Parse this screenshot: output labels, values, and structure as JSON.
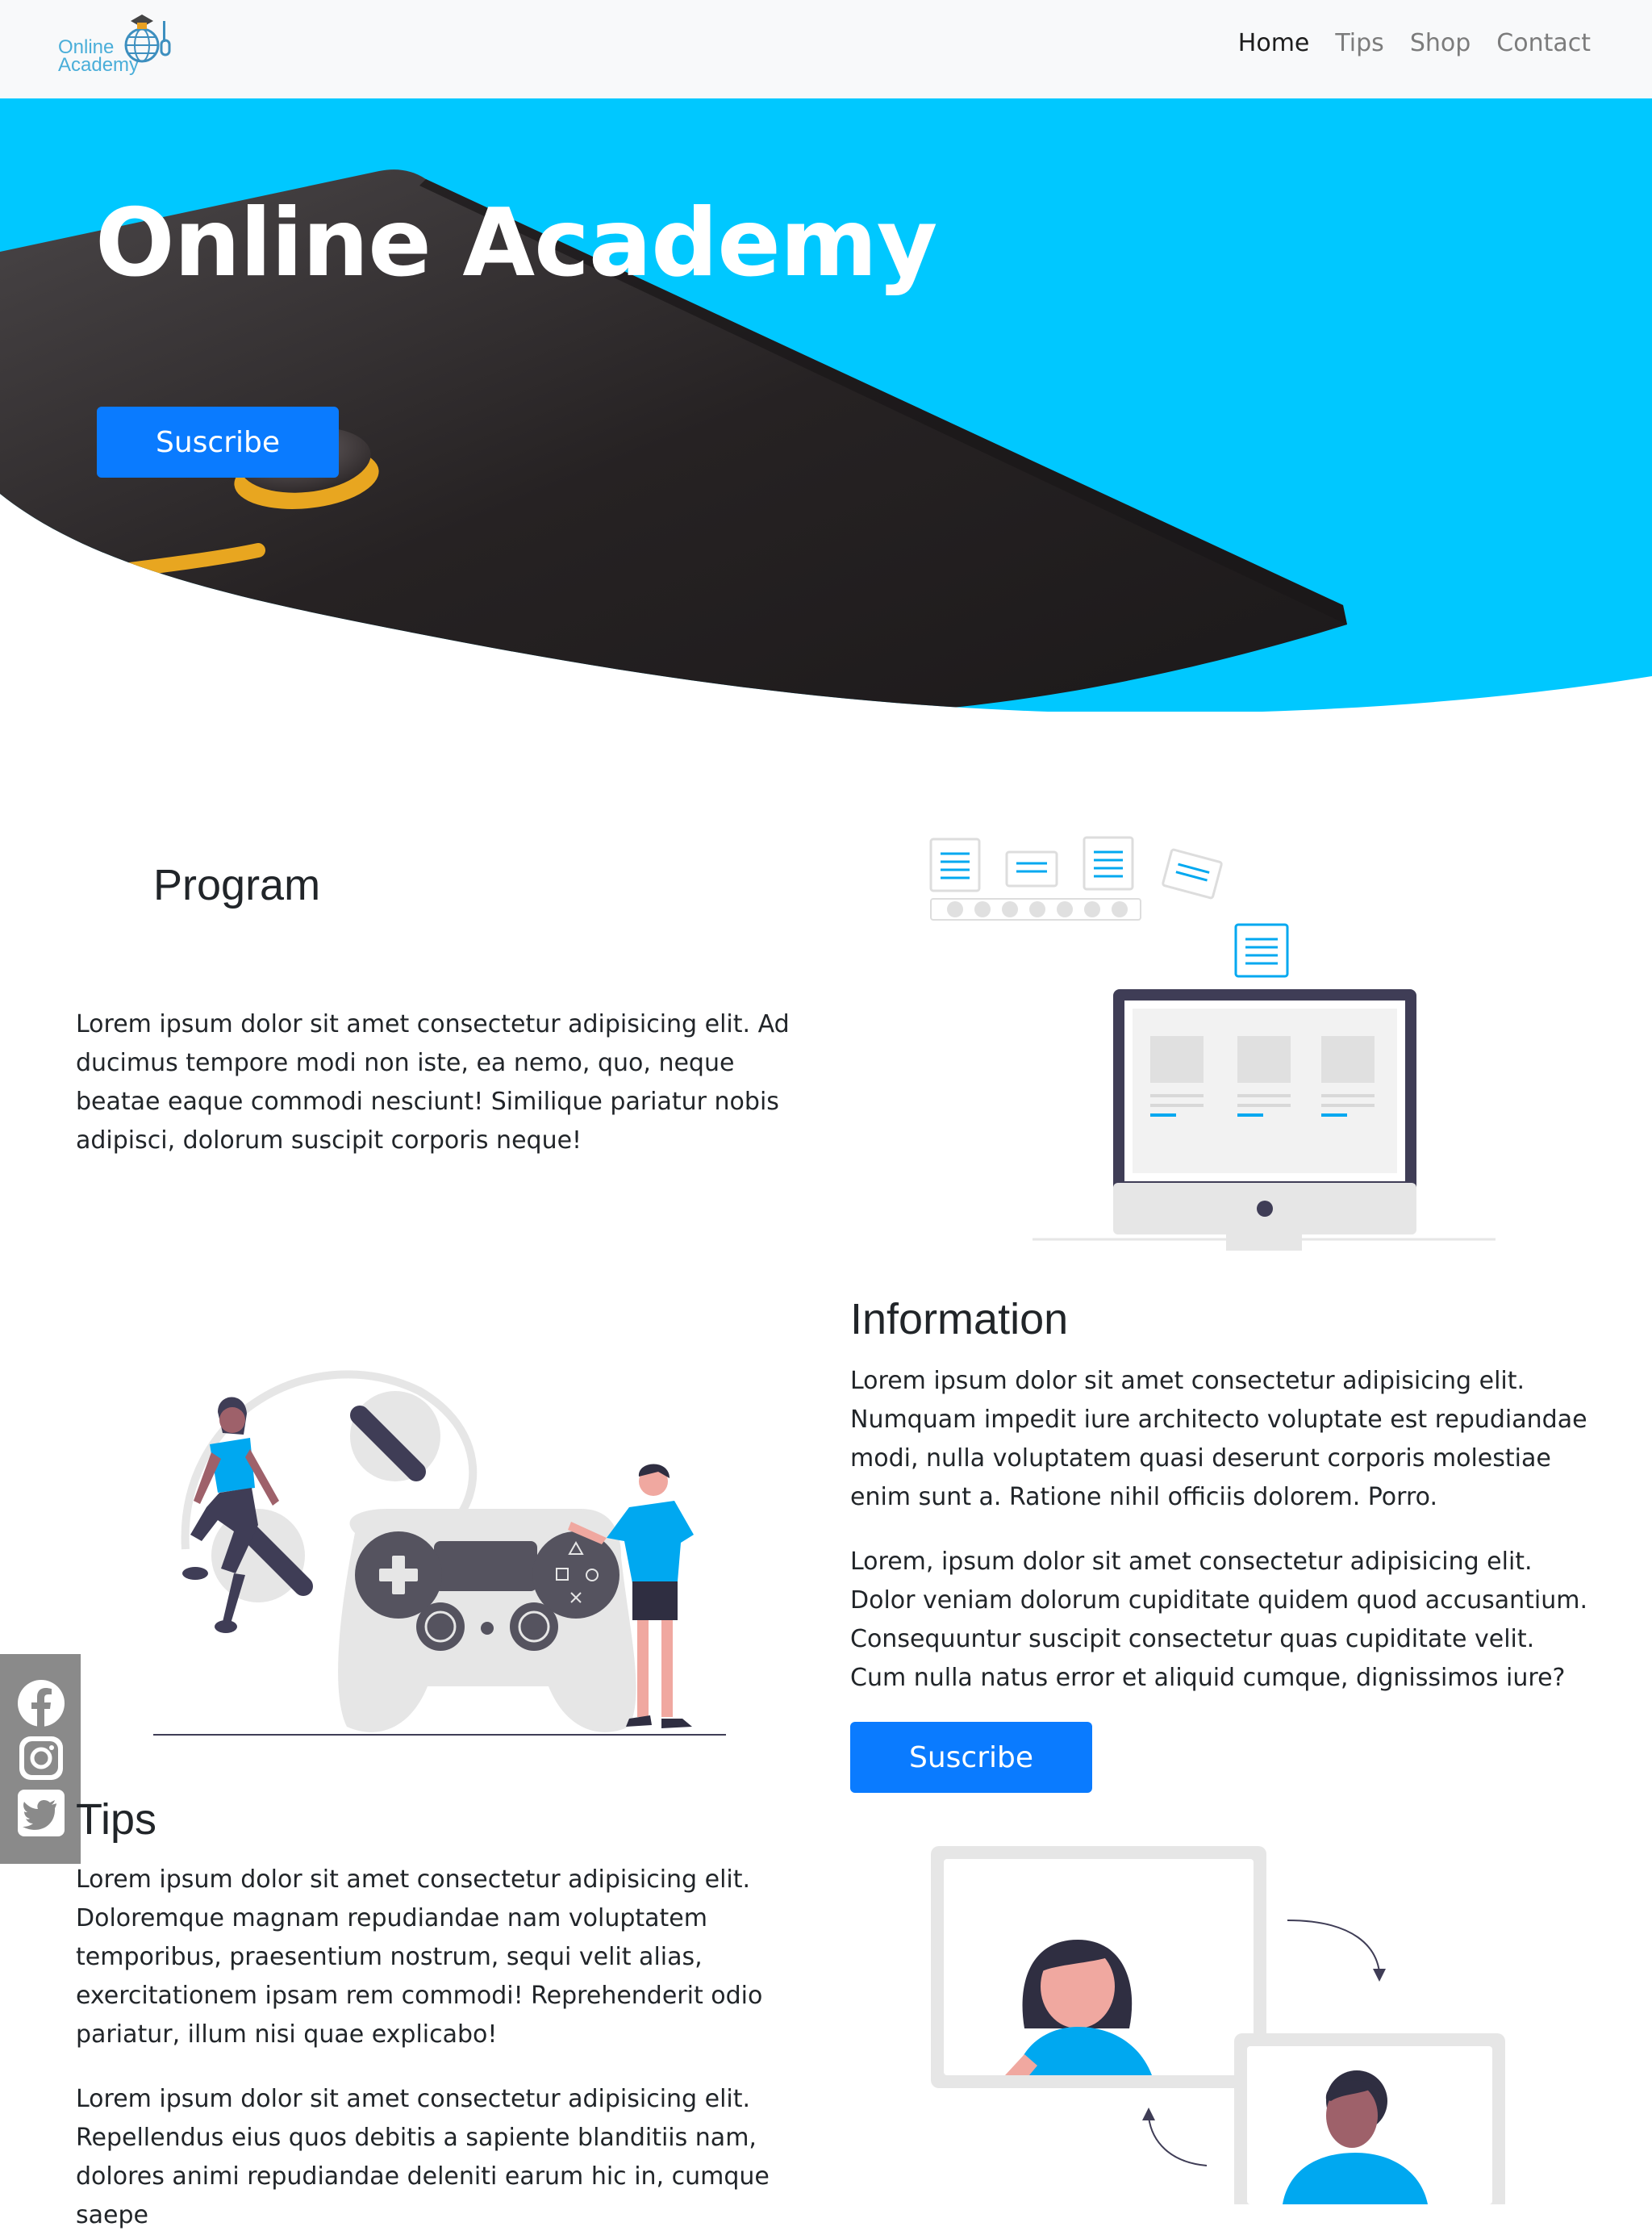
{
  "logo": {
    "line1": "Online",
    "line2": "Academy"
  },
  "nav": {
    "items": [
      {
        "label": "Home",
        "active": true
      },
      {
        "label": "Tips",
        "active": false
      },
      {
        "label": "Shop",
        "active": false
      },
      {
        "label": "Contact",
        "active": false
      }
    ]
  },
  "hero": {
    "title": "Online Academy",
    "button_label": "Suscribe"
  },
  "program": {
    "title": "Program",
    "text": "Lorem ipsum dolor sit amet consectetur adipisicing elit. Ad ducimus tempore modi non iste, ea nemo, quo, neque beatae eaque commodi nesciunt! Similique pariatur nobis adipisci, dolorum suscipit corporis neque!"
  },
  "information": {
    "title": "Information",
    "paragraphs": [
      "Lorem ipsum dolor sit amet consectetur adipisicing elit. Numquam impedit iure architecto voluptate est repudiandae modi, nulla voluptatem quasi deserunt corporis molestiae enim sunt a. Ratione nihil officiis dolorem. Porro.",
      "Lorem, ipsum dolor sit amet consectetur adipisicing elit. Dolor veniam dolorum cupiditate quidem quod accusantium. Consequuntur suscipit consectetur quas cupiditate velit. Cum nulla natus error et aliquid cumque, dignissimos iure?"
    ],
    "button_label": "Suscribe"
  },
  "tips": {
    "title": "Tips",
    "paragraphs": [
      "Lorem ipsum dolor sit amet consectetur adipisicing elit. Doloremque magnam repudiandae nam voluptatem temporibus, praesentium nostrum, sequi velit alias, exercitationem ipsam rem commodi! Reprehenderit odio pariatur, illum nisi quae explicabo!",
      "Lorem ipsum dolor sit amet consectetur adipisicing elit. Repellendus eius quos debitis a sapiente blanditiis nam, dolores animi repudiandae deleniti earum hic in, cumque saepe"
    ]
  },
  "social": {
    "icons": [
      "facebook-icon",
      "instagram-icon",
      "twitter-icon"
    ]
  },
  "colors": {
    "accent": "#0a7bff",
    "hero_bg": "#00c8ff",
    "illustration_blue": "#00a8f0",
    "dark": "#3f3d56"
  }
}
